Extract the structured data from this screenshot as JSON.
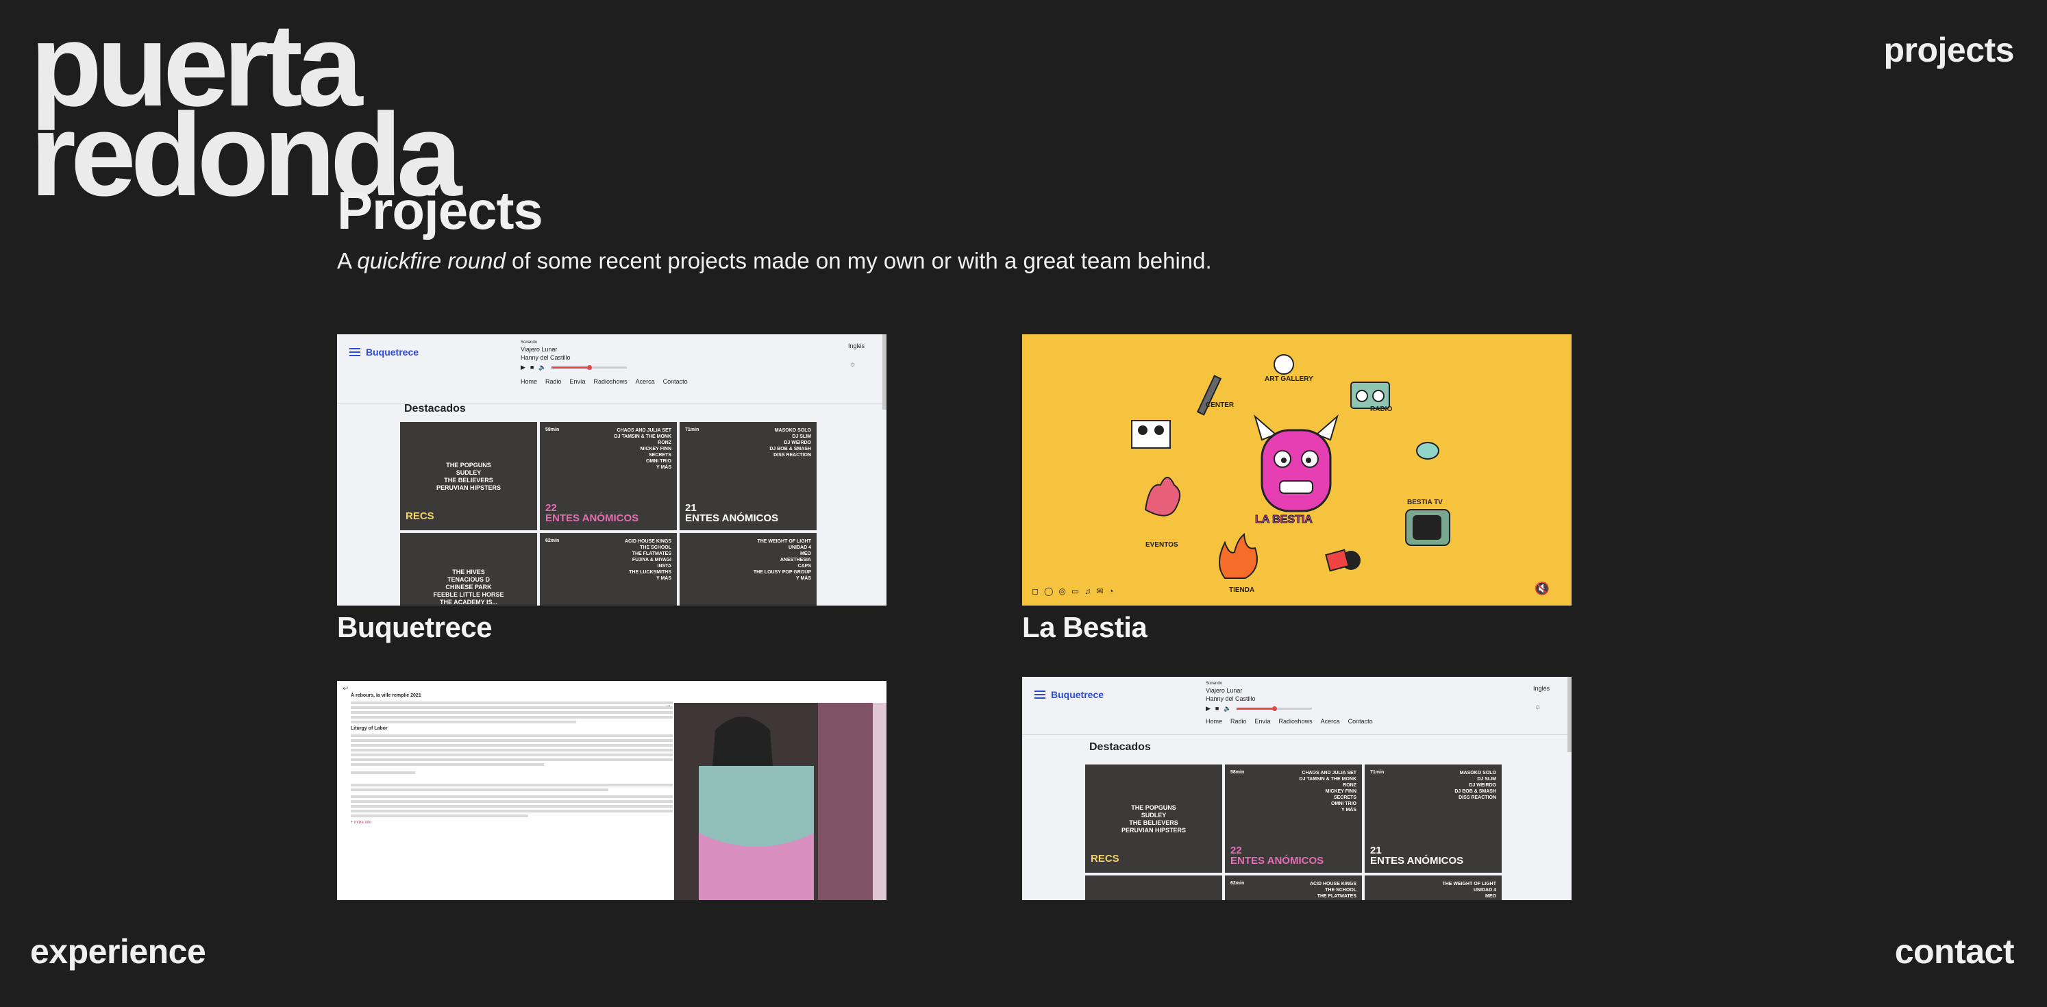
{
  "site": {
    "logo_line1": "puerta",
    "logo_line2": "redonda"
  },
  "nav": {
    "projects": "projects",
    "experience": "experience",
    "contact": "contact"
  },
  "page": {
    "title": "Projects",
    "intro_prefix": "A ",
    "intro_emphasis": "quickfire round",
    "intro_suffix": " of some recent projects made on my own or with a great team behind."
  },
  "projects": [
    {
      "name": "Buquetrece",
      "preview": {
        "brand": "Buquetrece",
        "now_playing_label": "Sonando",
        "track": "Viajero Lunar",
        "artist": "Hanny del Castillo",
        "menu": [
          "Home",
          "Radio",
          "Envía",
          "Radioshows",
          "Acerca",
          "Contacto"
        ],
        "language": "Inglés",
        "section": "Destacados",
        "tiles": [
          {
            "time": "",
            "lines": [
              "THE POPGUNS",
              "SUDLEY",
              "THE BELIEVERS",
              "PERUVIAN HIPSTERS"
            ],
            "big": "RECS",
            "kind": "recs"
          },
          {
            "time": "58min",
            "lines": [
              "CHAOS AND JULIA SET",
              "DJ TAMSIN & THE MONK",
              "RONZ",
              "MICKEY FINN",
              "SECRETS",
              "OMNI TRIO",
              "Y MÁS"
            ],
            "big_num": "22",
            "big": "ENTES ANÓMICOS",
            "kind": "pink"
          },
          {
            "time": "71min",
            "lines": [
              "MASOKO SOLO",
              "DJ SLIM",
              "DJ WEIRDO",
              "DJ BOB & SMASH",
              "DISS REACTION"
            ],
            "big_num": "21",
            "big": "ENTES ANÓMICOS",
            "kind": "white"
          },
          {
            "time": "",
            "lines": [
              "THE HIVES",
              "TENACIOUS D",
              "CHINESE PARK",
              "FEEBLE LITTLE HORSE",
              "THE ACADEMY IS..."
            ],
            "kind": "center"
          },
          {
            "time": "62min",
            "lines": [
              "ACID HOUSE KINGS",
              "THE SCHOOL",
              "THE FLATMATES",
              "FUJIYA & MIYAGI",
              "INSTA",
              "THE LUCKSMITHS",
              "Y MÁS"
            ],
            "kind": "list"
          },
          {
            "time": "",
            "lines": [
              "THE WEIGHT OF LIGHT",
              "UNIDAD 4",
              "MEO",
              "ANESTHESIA",
              "CAPS",
              "THE LOUSY POP GROUP",
              "Y MÁS"
            ],
            "kind": "list"
          }
        ]
      }
    },
    {
      "name": "La Bestia",
      "preview": {
        "labels": [
          "ART GALLERY",
          "RADIO",
          "CENTER",
          "LA BESTIA",
          "EVENTOS",
          "BESTIA TV",
          "TIENDA"
        ]
      }
    },
    {
      "name": "",
      "preview": {
        "heading": "À rebours, la ville remplie 2021",
        "subheading": "Liturgy of Labor",
        "more": "+ more info"
      }
    },
    {
      "name": "",
      "preview": {
        "brand": "Buquetrece",
        "now_playing_label": "Sonando",
        "track": "Viajero Lunar",
        "artist": "Hanny del Castillo",
        "menu": [
          "Home",
          "Radio",
          "Envía",
          "Radioshows",
          "Acerca",
          "Contacto"
        ],
        "language": "Inglés",
        "section": "Destacados",
        "tiles": [
          {
            "lines": [
              "THE POPGUNS",
              "SUDLEY",
              "THE BELIEVERS",
              "PERUVIAN HIPSTERS"
            ],
            "big": "RECS"
          },
          {
            "time": "58min",
            "lines": [
              "CHAOS AND JULIA SET",
              "DJ TAMSIN & THE MONK",
              "RONZ",
              "MICKEY FINN",
              "SECRETS",
              "OMNI TRIO",
              "Y MÁS"
            ],
            "big_num": "22",
            "big": "ENTES ANÓMICOS"
          },
          {
            "time": "71min",
            "lines": [
              "MASOKO SOLO",
              "DJ SLIM",
              "DJ WEIRDO",
              "DJ BOB & SMASH",
              "DISS REACTION"
            ],
            "big_num": "21",
            "big": "ENTES ANÓMICOS"
          },
          {
            "lines": []
          },
          {
            "time": "62min",
            "lines": [
              "ACID HOUSE KINGS",
              "THE SCHOOL",
              "THE FLATMATES"
            ]
          },
          {
            "lines": [
              "THE WEIGHT OF LIGHT",
              "UNIDAD 4",
              "MEO"
            ]
          }
        ]
      }
    }
  ],
  "colors": {
    "background": "#1e1e1e",
    "text": "#f0f0f0",
    "bestia_yellow": "#f6c33f",
    "buquetrece_blue": "#2d4ad6",
    "accent_pink": "#e36fb3"
  }
}
